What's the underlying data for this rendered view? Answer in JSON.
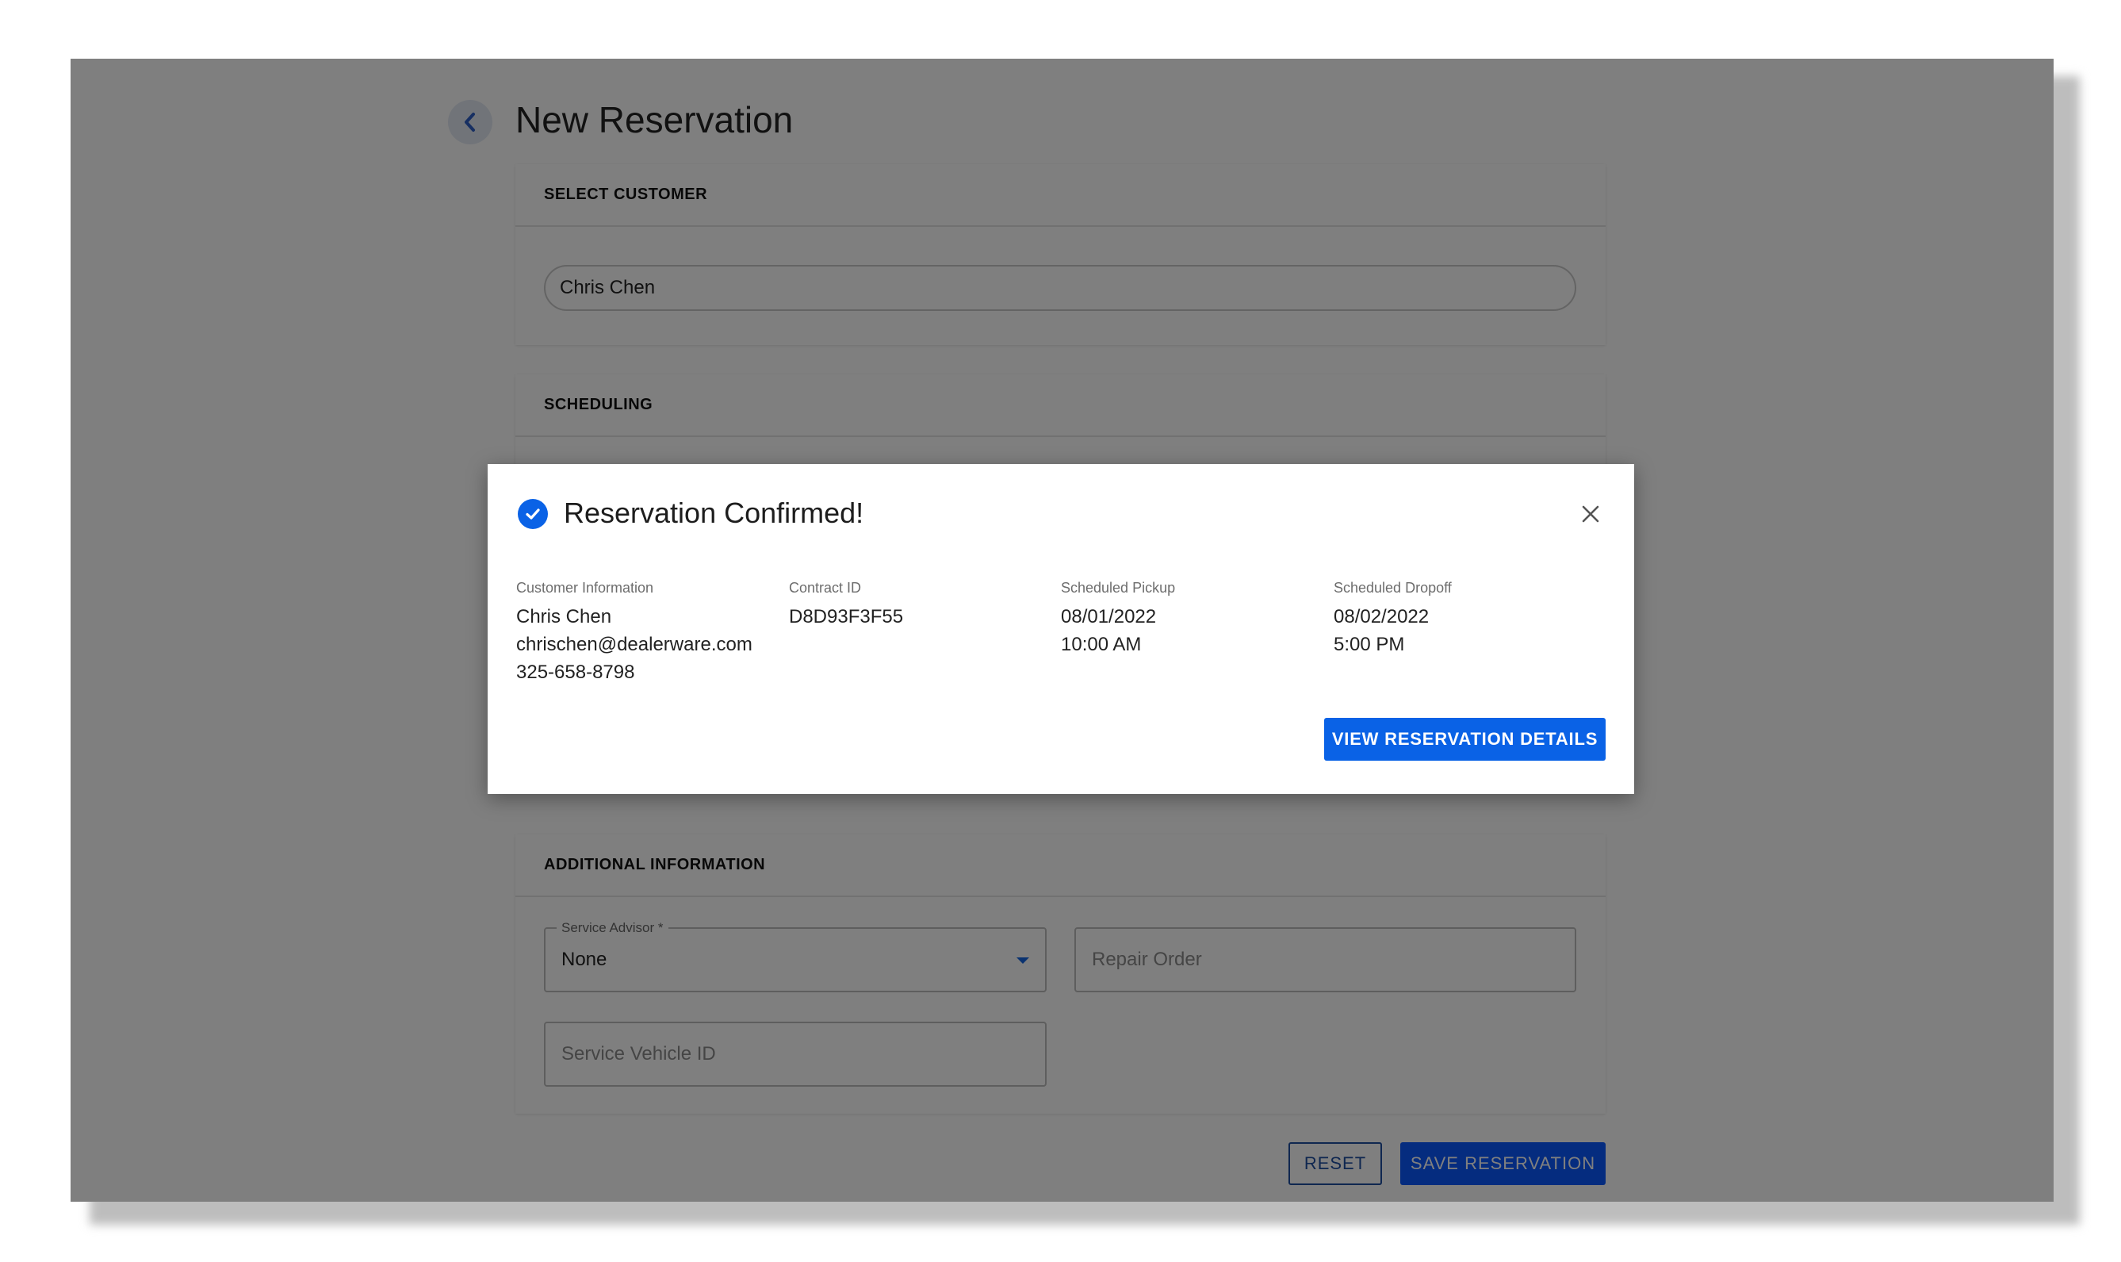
{
  "page": {
    "title": "New Reservation"
  },
  "select_customer": {
    "header": "SELECT CUSTOMER",
    "value": "Chris Chen"
  },
  "scheduling": {
    "header": "SCHEDULING"
  },
  "additional_information": {
    "header": "ADDITIONAL INFORMATION",
    "service_advisor_label": "Service Advisor *",
    "service_advisor_value": "None",
    "repair_order_placeholder": "Repair Order",
    "service_vehicle_placeholder": "Service Vehicle ID"
  },
  "actions": {
    "reset_label": "RESET",
    "save_label": "SAVE RESERVATION"
  },
  "modal": {
    "title": "Reservation Confirmed!",
    "customer_label": "Customer Information",
    "customer_name": "Chris Chen",
    "customer_email": "chrischen@dealerware.com",
    "customer_phone": "325-658-8798",
    "contract_label": "Contract ID",
    "contract_id": "D8D93F3F55",
    "pickup_label": "Scheduled Pickup",
    "pickup_date": "08/01/2022",
    "pickup_time": "10:00 AM",
    "dropoff_label": "Scheduled Dropoff",
    "dropoff_date": "08/02/2022",
    "dropoff_time": "5:00 PM",
    "view_button_label": "VIEW RESERVATION DETAILS"
  },
  "icons": {
    "back": "chevron-left-icon",
    "check": "check-circle-icon",
    "close": "close-icon",
    "dropdown": "caret-down-icon"
  },
  "colors": {
    "accent": "#0a62e6",
    "primary_button": "#0a58ff"
  }
}
